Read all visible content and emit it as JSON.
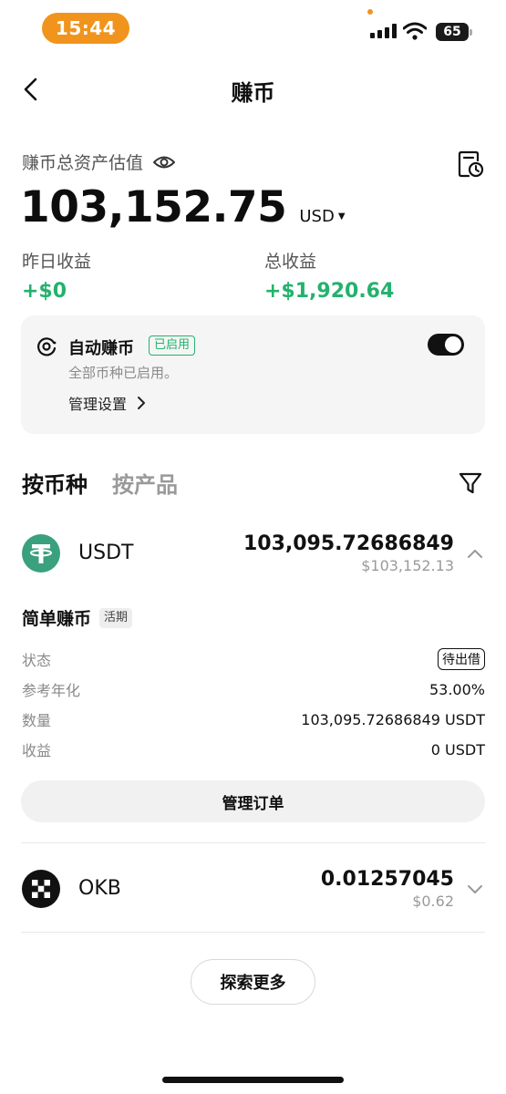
{
  "status_bar": {
    "time": "15:44",
    "battery": "65"
  },
  "nav": {
    "title": "赚币"
  },
  "summary": {
    "label": "赚币总资产估值",
    "total": "103,152.75",
    "currency": "USD",
    "yesterday_label": "昨日收益",
    "yesterday_value": "+$0",
    "total_earn_label": "总收益",
    "total_earn_value": "+$1,920.64"
  },
  "auto_earn": {
    "title": "自动赚币",
    "badge": "已启用",
    "subtitle": "全部币种已启用。",
    "manage_label": "管理设置",
    "enabled": true
  },
  "tabs": [
    {
      "label": "按币种",
      "active": true
    },
    {
      "label": "按产品",
      "active": false
    }
  ],
  "assets": [
    {
      "name": "USDT",
      "amount": "103,095.72686849",
      "fiat": "$103,152.13",
      "expanded": true,
      "product": {
        "title": "简单赚币",
        "tag": "活期",
        "rows": [
          {
            "label": "状态",
            "value": "待出借"
          },
          {
            "label": "参考年化",
            "value": "53.00%"
          },
          {
            "label": "数量",
            "value": "103,095.72686849 USDT"
          },
          {
            "label": "收益",
            "value": "0 USDT"
          }
        ],
        "button": "管理订单"
      }
    },
    {
      "name": "OKB",
      "amount": "0.01257045",
      "fiat": "$0.62",
      "expanded": false
    }
  ],
  "explore_button": "探索更多",
  "colors": {
    "accent_green": "#23b26d",
    "status_orange": "#f0941d",
    "tether_green": "#3aa07e"
  }
}
